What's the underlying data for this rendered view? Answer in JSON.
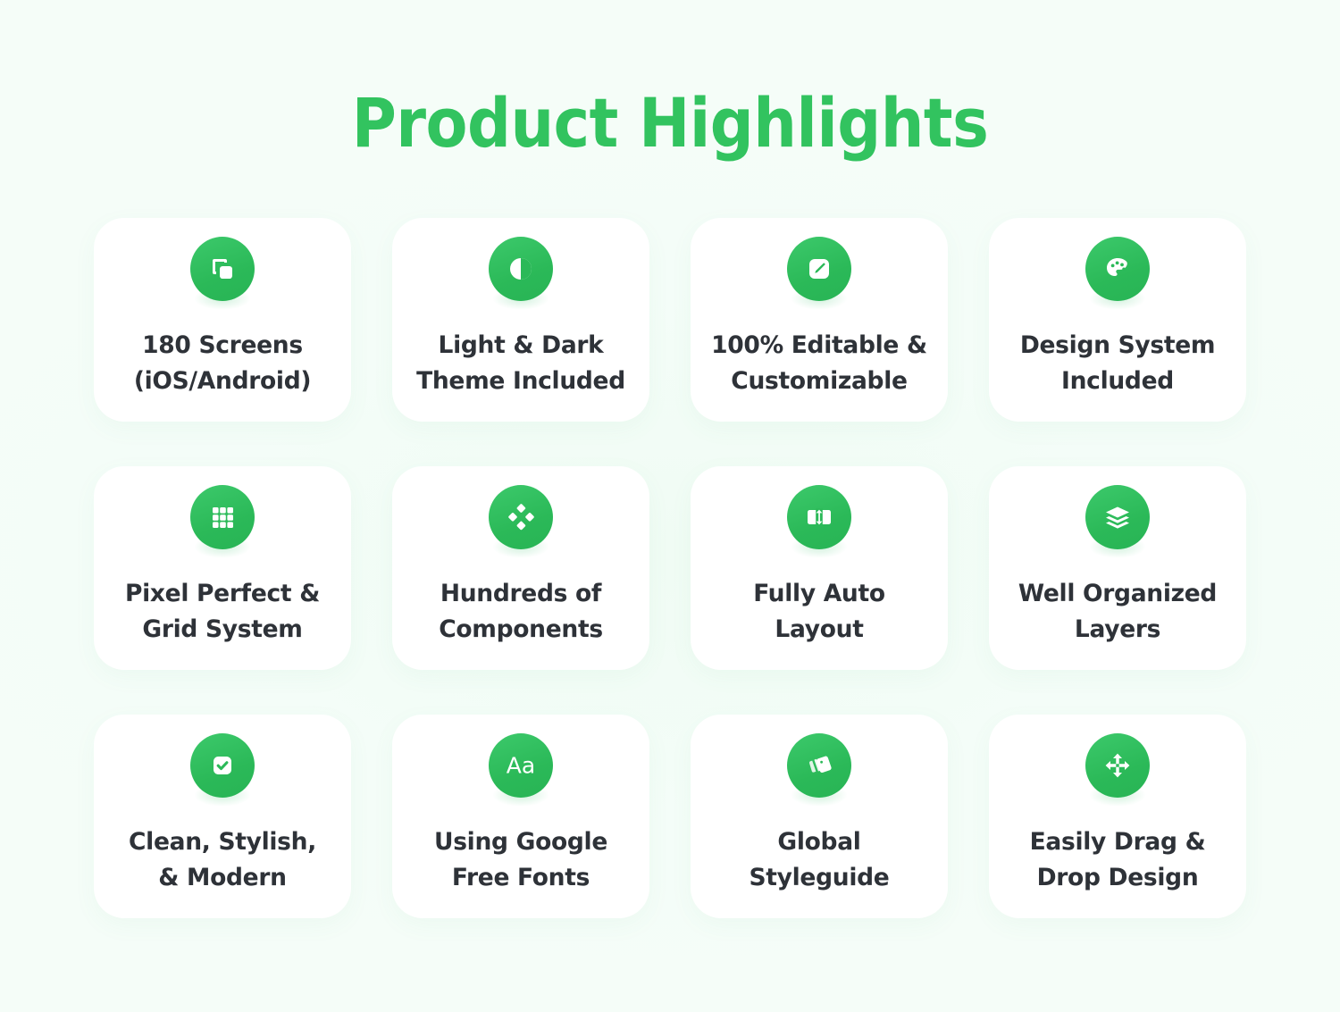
{
  "page": {
    "title": "Product Highlights",
    "background_color": "#f3fdf7",
    "accent_color": "#2bb958",
    "card_color": "#ffffff",
    "text_color": "#2e3238"
  },
  "cards": [
    {
      "icon": "copy-screens-icon",
      "label": "180 Screens\n(iOS/Android)"
    },
    {
      "icon": "contrast-theme-icon",
      "label": "Light & Dark\nTheme Included"
    },
    {
      "icon": "edit-pencil-icon",
      "label": "100% Editable &\nCustomizable"
    },
    {
      "icon": "color-palette-icon",
      "label": "Design System\nIncluded"
    },
    {
      "icon": "grid-dots-icon",
      "label": "Pixel Perfect &\nGrid System"
    },
    {
      "icon": "components-diamond-icon",
      "label": "Hundreds of\nComponents"
    },
    {
      "icon": "auto-layout-icon",
      "label": "Fully Auto\nLayout"
    },
    {
      "icon": "layers-stack-icon",
      "label": "Well Organized\nLayers"
    },
    {
      "icon": "check-square-icon",
      "label": "Clean, Stylish,\n& Modern"
    },
    {
      "icon": "typography-aa-icon",
      "label": "Using Google\nFree Fonts"
    },
    {
      "icon": "style-cards-icon",
      "label": "Global\nStyleguide"
    },
    {
      "icon": "move-arrows-icon",
      "label": "Easily Drag &\nDrop Design"
    }
  ]
}
